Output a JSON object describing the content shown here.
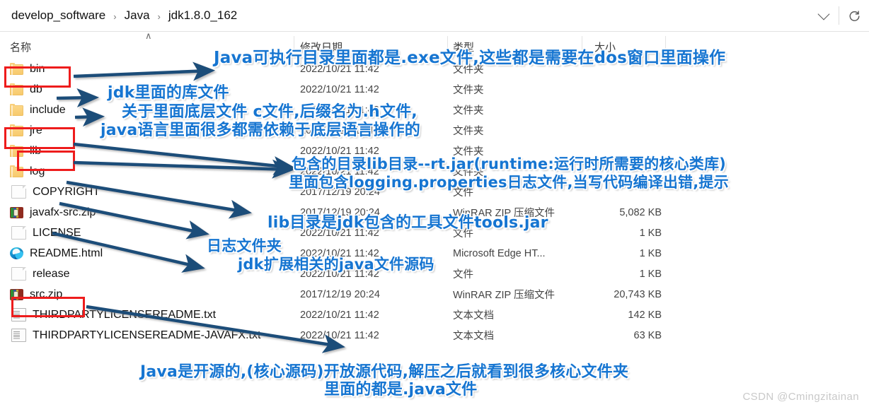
{
  "breadcrumb": {
    "items": [
      "develop_software",
      "Java",
      "jdk1.8.0_162"
    ],
    "separator": "›"
  },
  "toolbar": {
    "dropdown_label": "⌄",
    "refresh_label": "↻"
  },
  "columns": {
    "name": "名称",
    "date": "修改日期",
    "type": "类型",
    "size": "大小",
    "sort_indicator": "∧"
  },
  "files": [
    {
      "name": "bin",
      "icon": "folder-icon",
      "date": "2022/10/21 11:42",
      "type": "文件夹",
      "size": "",
      "highlighted": true
    },
    {
      "name": "db",
      "icon": "folder-icon",
      "date": "2022/10/21 11:42",
      "type": "文件夹",
      "size": "",
      "highlighted": false
    },
    {
      "name": "include",
      "icon": "folder-icon",
      "date": "2022/10/21 11:42",
      "type": "文件夹",
      "size": "",
      "highlighted": false
    },
    {
      "name": "jre",
      "icon": "folder-icon",
      "date": "2022/10/21 11:42",
      "type": "文件夹",
      "size": "",
      "highlighted": true
    },
    {
      "name": "lib",
      "icon": "folder-icon",
      "date": "2022/10/21 11:42",
      "type": "文件夹",
      "size": "",
      "highlighted": true
    },
    {
      "name": "log",
      "icon": "folder-icon",
      "date": "2022/10/21 11:42",
      "type": "文件夹",
      "size": "",
      "highlighted": false
    },
    {
      "name": "COPYRIGHT",
      "icon": "document-icon",
      "date": "2017/12/19 20:24",
      "type": "文件",
      "size": "",
      "highlighted": false
    },
    {
      "name": "javafx-src.zip",
      "icon": "zip-archive-icon",
      "date": "2017/12/19 20:24",
      "type": "WinRAR ZIP 压缩文件",
      "size": "5,082 KB",
      "highlighted": false
    },
    {
      "name": "LICENSE",
      "icon": "document-icon",
      "date": "2022/10/21 11:42",
      "type": "文件",
      "size": "1 KB",
      "highlighted": false
    },
    {
      "name": "README.html",
      "icon": "edge-browser-icon",
      "date": "2022/10/21 11:42",
      "type": "Microsoft Edge HT...",
      "size": "1 KB",
      "highlighted": false
    },
    {
      "name": "release",
      "icon": "document-icon",
      "date": "2022/10/21 11:42",
      "type": "文件",
      "size": "1 KB",
      "highlighted": false
    },
    {
      "name": "src.zip",
      "icon": "zip-archive-icon",
      "date": "2017/12/19 20:24",
      "type": "WinRAR ZIP 压缩文件",
      "size": "20,743 KB",
      "highlighted": true
    },
    {
      "name": "THIRDPARTYLICENSEREADME.txt",
      "icon": "text-file-icon",
      "date": "2022/10/21 11:42",
      "type": "文本文档",
      "size": "142 KB",
      "highlighted": false
    },
    {
      "name": "THIRDPARTYLICENSEREADME-JAVAFX.txt",
      "icon": "text-file-icon",
      "date": "2022/10/21 11:42",
      "type": "文本文档",
      "size": "63 KB",
      "highlighted": false
    }
  ],
  "annotations": [
    {
      "id": "bin-note",
      "text": "Java可执行目录里面都是.exe文件,这些都是需要在dos窗口里面操作"
    },
    {
      "id": "db-note",
      "text": "jdk里面的库文件"
    },
    {
      "id": "include-note1",
      "text": "关于里面底层文件 c文件,后缀名为.h文件,"
    },
    {
      "id": "include-note2",
      "text": "java语言里面很多都需依赖于底层语言操作的"
    },
    {
      "id": "jre-note1",
      "text": "包含的目录lib目录--rt.jar(runtime:运行时所需要的核心类库)"
    },
    {
      "id": "jre-note2",
      "text": "里面包含logging.properties日志文件,当写代码编译出错,提示"
    },
    {
      "id": "lib-note",
      "text": "lib目录是jdk包含的工具文件tools.jar"
    },
    {
      "id": "log-note",
      "text": "日志文件夹"
    },
    {
      "id": "javafx-note",
      "text": "jdk扩展相关的java文件源码"
    },
    {
      "id": "src-note1",
      "text": "Java是开源的,(核心源码)开放源代码,解压之后就看到很多核心文件夹"
    },
    {
      "id": "src-note2",
      "text": "里面的都是.java文件"
    }
  ],
  "watermark": "CSDN @Cmingzitainan",
  "colors": {
    "annotation_blue": "#1675d1",
    "highlight_red": "#ee1c1c",
    "arrow_navy": "#1f4e79"
  }
}
